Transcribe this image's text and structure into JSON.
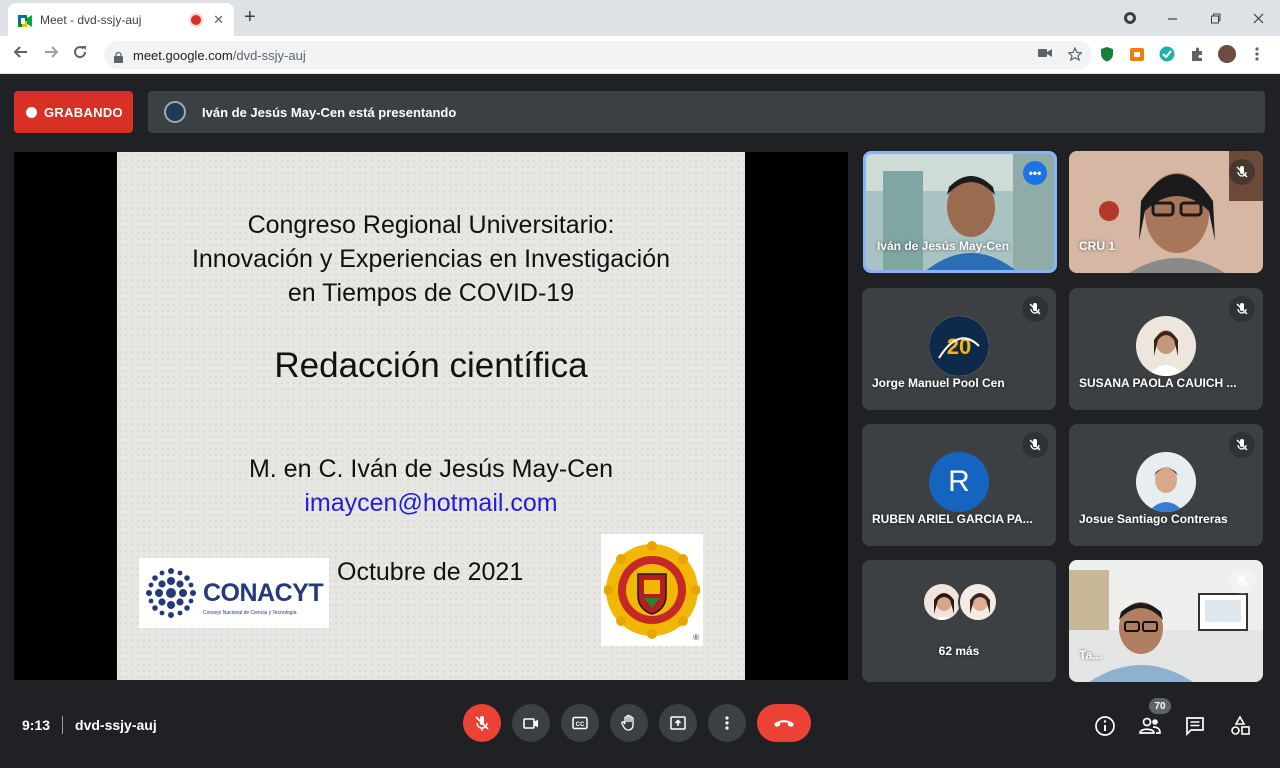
{
  "browser": {
    "tab_title": "Meet - dvd-ssjy-auj",
    "url_host": "meet.google.com",
    "url_path": "/dvd-ssjy-auj",
    "new_tab": "+",
    "tab_close": "✕"
  },
  "meet": {
    "recording_label": "GRABANDO",
    "presenting_text": "Iván de Jesús May-Cen está presentando",
    "accent_color": "#1a73e8",
    "record_color": "#d93025"
  },
  "slide": {
    "title_lines": [
      "Congreso Regional Universitario:",
      "Innovación y Experiencias en Investigación",
      "en Tiempos de COVID-19"
    ],
    "subtitle": "Redacción científica",
    "author": "M. en C. Iván de Jesús May-Cen",
    "email": "imaycen@hotmail.com",
    "date": "Octubre de 2021",
    "logo_text": "CONACYT",
    "logo_subtext": "Consejo Nacional de Ciencia y Tecnología",
    "seal_mark": "®"
  },
  "participants": [
    {
      "name": "Iván de Jesús May-Cen",
      "active": true,
      "more_icon": "•••"
    },
    {
      "name": "CRU 1"
    },
    {
      "name": "Jorge Manuel Pool Cen"
    },
    {
      "name": "SUSANA PAOLA CAUICH ..."
    },
    {
      "name": "RUBEN ARIEL GARCIA PA...",
      "initial": "R"
    },
    {
      "name": "Josue Santiago Contreras"
    },
    {
      "name": "62 más"
    },
    {
      "name": "Ta..."
    }
  ],
  "bottom": {
    "time": "9:13",
    "meeting_code": "dvd-ssjy-auj",
    "people_count": "70"
  }
}
